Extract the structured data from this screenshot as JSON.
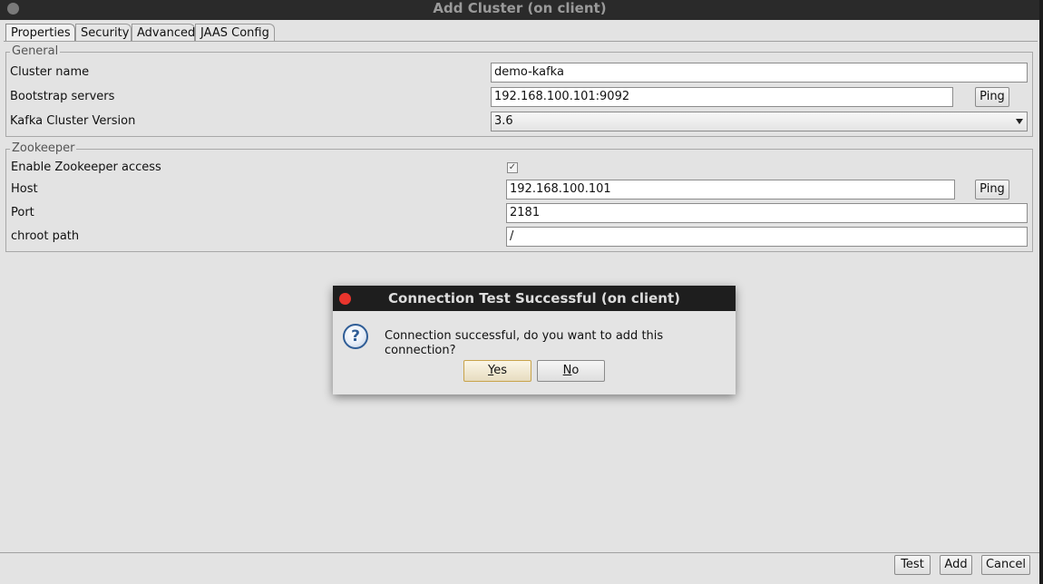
{
  "window": {
    "title": "Add Cluster (on client)"
  },
  "tabs": [
    "Properties",
    "Security",
    "Advanced",
    "JAAS Config"
  ],
  "general": {
    "legend": "General",
    "cluster_name_label": "Cluster name",
    "cluster_name_value": "demo-kafka",
    "bootstrap_label": "Bootstrap servers",
    "bootstrap_value": "192.168.100.101:9092",
    "ping_label": "Ping",
    "version_label": "Kafka Cluster Version",
    "version_value": "3.6"
  },
  "zookeeper": {
    "legend": "Zookeeper",
    "enable_label": "Enable Zookeeper access",
    "enable_checked": true,
    "host_label": "Host",
    "host_value": "192.168.100.101",
    "ping_label": "Ping",
    "port_label": "Port",
    "port_value": "2181",
    "chroot_label": "chroot path",
    "chroot_value": "/"
  },
  "dialog": {
    "title": "Connection Test Successful (on client)",
    "message": "Connection successful, do you want to add this connection?",
    "yes_mnemonic": "Y",
    "yes_rest": "es",
    "no_mnemonic": "N",
    "no_rest": "o",
    "icon": "question-icon"
  },
  "footer": {
    "test_label": "Test",
    "add_label": "Add",
    "cancel_label": "Cancel"
  }
}
